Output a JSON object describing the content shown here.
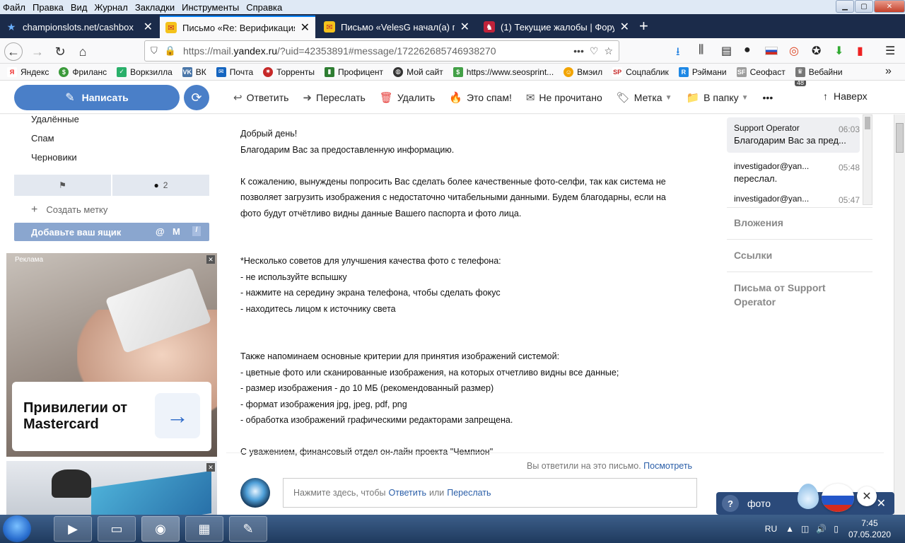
{
  "menu": [
    "Файл",
    "Правка",
    "Вид",
    "Журнал",
    "Закладки",
    "Инструменты",
    "Справка"
  ],
  "tabs": [
    {
      "title": "championslots.net/cashbox",
      "icon": "star-icon"
    },
    {
      "title": "Письмо «Re: Верификация ак",
      "icon": "yandex-mail-icon"
    },
    {
      "title": "Письмо «VelesG начал(а) пер",
      "icon": "yandex-mail-icon"
    },
    {
      "title": "(1) Текущие жалобы | Форум",
      "icon": "forum-icon"
    }
  ],
  "nav": {
    "url_prefix": "https://mail.",
    "url_domain": "yandex.ru",
    "url_rest": "/?uid=42353891#message/172262685746938270",
    "ext_badge": "48"
  },
  "bookmarks": [
    "Яндекс",
    "Фриланс",
    "Воркзилла",
    "ВК",
    "Почта",
    "Торренты",
    "Профицент",
    "Мой сайт",
    "https://www.seosprint...",
    "Вмэил",
    "Соцпаблик",
    "Рэймани",
    "Сеофаст",
    "Вебайни"
  ],
  "mail_toolbar": {
    "compose": "Написать",
    "reply": "Ответить",
    "forward": "Переслать",
    "delete": "Удалить",
    "spam": "Это спам!",
    "unread": "Не прочитано",
    "label": "Метка",
    "folder": "В папку",
    "to_top": "Наверх"
  },
  "sidebar": {
    "folders": [
      "Удалённые",
      "Спам",
      "Черновики"
    ],
    "flag_count": "2",
    "create_label": "Создать метку",
    "add_box": "Добавьте ваш ящик"
  },
  "ads": {
    "label": "Реклама",
    "title": "Привилегии от Mastercard"
  },
  "letter": [
    "Добрый день!",
    "Благодарим Вас за предоставленную информацию.",
    "",
    "К сожалению, вынуждены попросить Вас сделать более качественные фото-селфи, так как система не",
    "позволяет загрузить изображения с недостаточно читабельными данными. Будем благодарны, если на",
    "фото будут отчётливо видны данные Вашего паспорта и фото лица.",
    "",
    "",
    "*Несколько советов для улучшения качества фото с телефона:",
    "- не используйте вспышку",
    "- нажмите на середину экрана телефона, чтобы сделать фокус",
    "- находитесь лицом к источнику света",
    "",
    "",
    "Также напоминаем основные критерии для принятия изображений системой:",
    "- цветные фото или сканированные изображения, на которых отчетливо видны все данные;",
    "- размер изображения - до 10 МБ (рекомендованный размер)",
    "- формат изображения jpg, jpeg, pdf, png",
    "- обработка изображений графическими редакторами запрещена.",
    "",
    "С уважением, финансовый отдел он-лайн проекта \"Чемпион\""
  ],
  "reply": {
    "info": "Вы ответили на это письмо.",
    "info_link": "Посмотреть",
    "prompt_start": "Нажмите здесь, чтобы",
    "prompt_reply": "Ответить",
    "prompt_or": "или",
    "prompt_forward": "Переслать"
  },
  "thread": [
    {
      "from": "Support Operator",
      "time": "06:03",
      "preview": "Благодарим Вас за пред..."
    },
    {
      "from": "investigador@yan...",
      "time": "05:48",
      "preview": "переслал."
    },
    {
      "from": "investigador@yan...",
      "time": "05:47",
      "preview": ""
    }
  ],
  "right_sections": [
    "Вложения",
    "Ссылки",
    "Письма от Support Operator"
  ],
  "bubble": {
    "text": "фото"
  },
  "tray": {
    "lang": "RU",
    "time": "7:45",
    "date": "07.05.2020"
  },
  "colors": {
    "accent": "#4a7fc8",
    "tabbar": "#1b2b4a",
    "link": "#2a5ea8"
  }
}
